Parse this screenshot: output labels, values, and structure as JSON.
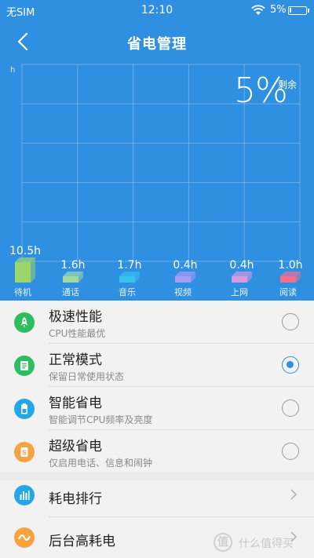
{
  "status_bar": {
    "carrier": "无SIM",
    "time": "12:10",
    "battery": "5%"
  },
  "header": {
    "title": "省电管理"
  },
  "chart_data": {
    "type": "bar",
    "y_unit": "h",
    "remaining_value": "5%",
    "remaining_label": "剩余",
    "categories": [
      "待机",
      "通话",
      "音乐",
      "视频",
      "上网",
      "阅读"
    ],
    "values": [
      10.5,
      1.6,
      1.7,
      0.4,
      0.4,
      1.0
    ],
    "value_labels": [
      "10.5h",
      "1.6h",
      "1.7h",
      "0.4h",
      "0.4h",
      "1.0h"
    ],
    "colors": [
      "#9dd56b",
      "#9fd8a2",
      "#38c1f0",
      "#a89bf5",
      "#d49be0",
      "#f46e92"
    ]
  },
  "modes": [
    {
      "title": "极速性能",
      "desc": "CPU性能最优",
      "icon": "rocket-icon",
      "color": "#2cbf5f",
      "selected": false
    },
    {
      "title": "正常模式",
      "desc": "保留日常使用状态",
      "icon": "document-icon",
      "color": "#2cbf5f",
      "selected": true
    },
    {
      "title": "智能省电",
      "desc": "智能调节CPU频率及亮度",
      "icon": "battery-icon",
      "color": "#23a7ea",
      "selected": false
    },
    {
      "title": "超级省电",
      "desc": "仅启用电话、信息和闹钟",
      "icon": "super-save-icon",
      "color": "#f5a340",
      "selected": false
    }
  ],
  "nav": [
    {
      "title": "耗电排行",
      "icon": "bar-chart-icon",
      "color": "#23a7ea"
    },
    {
      "title": "后台高耗电",
      "icon": "wave-icon",
      "color": "#f5a340"
    }
  ],
  "watermark": {
    "logo": "值",
    "text": "什么值得买"
  }
}
